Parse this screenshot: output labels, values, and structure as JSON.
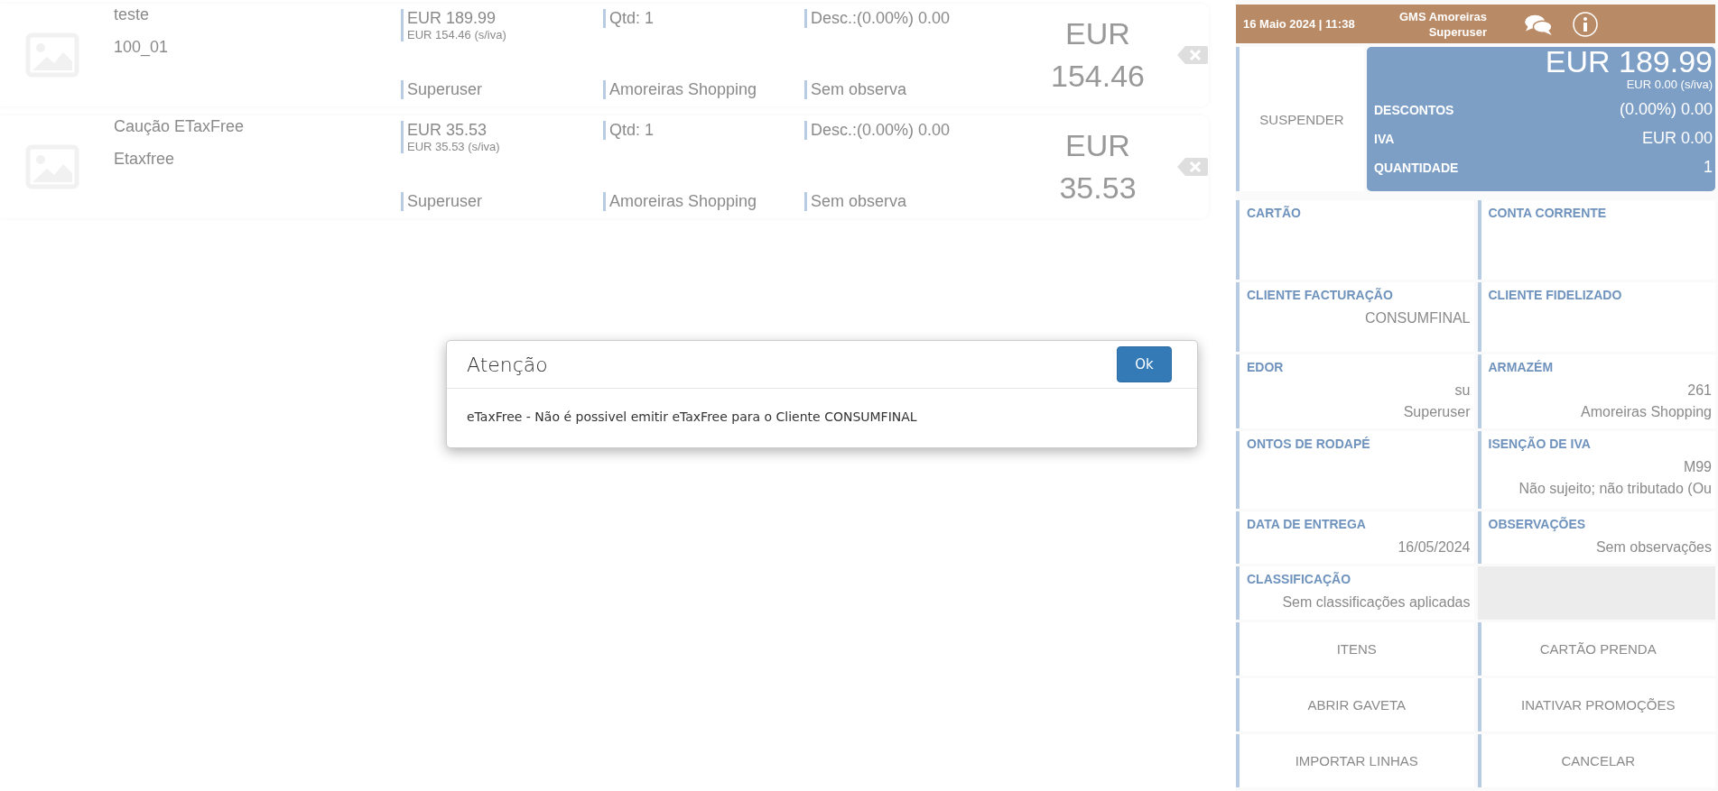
{
  "order_lines": [
    {
      "name": "teste",
      "code": "100_01",
      "price": "EUR 189.99",
      "price_net": "EUR 154.46 (s/iva)",
      "quantity": "Qtd: 1",
      "discount": "Desc.:(0.00%) 0.00",
      "user": "Superuser",
      "store": "Amoreiras Shopping",
      "notes": "Sem observa",
      "total_currency": "EUR",
      "total": "154.46"
    },
    {
      "name": "Caução ETaxFree",
      "code": "Etaxfree",
      "price": "EUR 35.53",
      "price_net": "EUR 35.53 (s/iva)",
      "quantity": "Qtd: 1",
      "discount": "Desc.:(0.00%) 0.00",
      "user": "Superuser",
      "store": "Amoreiras Shopping",
      "notes": "Sem observa",
      "total_currency": "EUR",
      "total": "35.53"
    }
  ],
  "header": {
    "datetime": "16 Maio 2024 | 11:38",
    "store": "GMS Amoreiras",
    "user": "Superuser"
  },
  "summary": {
    "suspend_button": "SUSPENDER",
    "total": "EUR 189.99",
    "total_net": "EUR 0.00 (s/iva)",
    "rows": [
      {
        "label": "DESCONTOS",
        "value": "(0.00%) 0.00"
      },
      {
        "label": "IVA",
        "value": "EUR 0.00"
      },
      {
        "label": "QUANTIDADE",
        "value": "1"
      }
    ]
  },
  "info_cells": [
    {
      "label": "CARTÃO"
    },
    {
      "label": "CONTA CORRENTE"
    },
    {
      "label": "CLIENTE FACTURAÇÃO",
      "values": [
        "CONSUMFINAL"
      ]
    },
    {
      "label": "CLIENTE FIDELIZADO"
    },
    {
      "label": "EDOR",
      "values": [
        "su",
        "Superuser"
      ]
    },
    {
      "label": "ARMAZÉM",
      "values": [
        "261",
        "Amoreiras Shopping"
      ]
    },
    {
      "label": "ONTOS DE RODAPÉ"
    },
    {
      "label": "ISENÇÃO DE IVA",
      "values": [
        "M99",
        "Não sujeito; não tributado (Ou"
      ]
    },
    {
      "label": "DATA DE ENTREGA",
      "values": [
        "16/05/2024"
      ]
    },
    {
      "label": "OBSERVAÇÕES",
      "values": [
        "Sem observações"
      ]
    },
    {
      "label": "CLASSIFICAÇÃO",
      "values": [
        "Sem classificações aplicadas"
      ]
    }
  ],
  "actions": [
    "ITENS",
    "CARTÃO PRENDA",
    "ABRIR GAVETA",
    "INATIVAR PROMOÇÕES",
    "IMPORTAR LINHAS",
    "CANCELAR"
  ],
  "dialog": {
    "title": "Atenção",
    "ok_button": "Ok",
    "message": "eTaxFree - Não é possivel emitir eTaxFree para o Cliente CONSUMFINAL"
  }
}
